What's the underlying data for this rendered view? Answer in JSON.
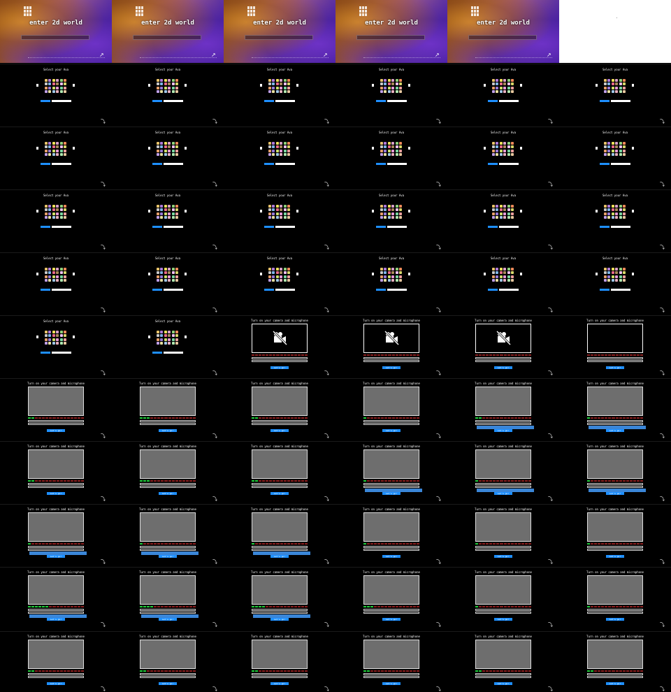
{
  "landing": {
    "hero_title": "enter 2d world",
    "corner_mark": "↗"
  },
  "avatar_screen": {
    "title": "Select your Ava",
    "continue_label": "",
    "random_label": "",
    "avatar_colors": [
      "#e8c36a",
      "#b07ad8",
      "#f2e25a",
      "#d9a0c8",
      "#8fd17a",
      "#f08a5a",
      "#c9c9c9",
      "#7fb6e8",
      "#e86a8a",
      "#a88a5a",
      "#f0c0f0",
      "#d8d86a",
      "#e8a06a",
      "#9a7ad8",
      "#cfe06a",
      "#e89ad8",
      "#7ad8a0",
      "#f0a0a0",
      "#c0a0e8",
      "#e8e0a0",
      "#a0c8e8",
      "#e8b0c0",
      "#b0e8b0",
      "#e8c8a0"
    ]
  },
  "camera_screen": {
    "title": "Turn on your camera and microphone",
    "camera_device": "",
    "mic_device": "",
    "go_label": "Let's go!",
    "icons": {
      "camera_off": "video-off-icon"
    }
  },
  "corner_glyph": "⤵",
  "frames": [
    {
      "kind": "landing",
      "variant": "cosmic"
    },
    {
      "kind": "landing",
      "variant": "cosmic"
    },
    {
      "kind": "landing",
      "variant": "cosmic"
    },
    {
      "kind": "landing",
      "variant": "cosmic"
    },
    {
      "kind": "landing",
      "variant": "cosmic"
    },
    {
      "kind": "blank",
      "variant": "white"
    },
    {
      "kind": "avatar"
    },
    {
      "kind": "avatar"
    },
    {
      "kind": "avatar"
    },
    {
      "kind": "avatar"
    },
    {
      "kind": "avatar"
    },
    {
      "kind": "avatar"
    },
    {
      "kind": "avatar"
    },
    {
      "kind": "avatar"
    },
    {
      "kind": "avatar"
    },
    {
      "kind": "avatar"
    },
    {
      "kind": "avatar"
    },
    {
      "kind": "avatar"
    },
    {
      "kind": "avatar"
    },
    {
      "kind": "avatar"
    },
    {
      "kind": "avatar"
    },
    {
      "kind": "avatar"
    },
    {
      "kind": "avatar"
    },
    {
      "kind": "avatar"
    },
    {
      "kind": "avatar"
    },
    {
      "kind": "avatar"
    },
    {
      "kind": "avatar"
    },
    {
      "kind": "avatar"
    },
    {
      "kind": "avatar"
    },
    {
      "kind": "avatar"
    },
    {
      "kind": "avatar"
    },
    {
      "kind": "avatar"
    },
    {
      "kind": "camera",
      "nocam": true,
      "icon": true,
      "meter_on": 0
    },
    {
      "kind": "camera",
      "nocam": true,
      "icon": true,
      "meter_on": 0
    },
    {
      "kind": "camera",
      "nocam": true,
      "icon": true,
      "meter_on": 0
    },
    {
      "kind": "camera",
      "nocam": true,
      "icon": false,
      "meter_on": 0
    },
    {
      "kind": "camera",
      "meter_on": 2
    },
    {
      "kind": "camera",
      "meter_on": 3
    },
    {
      "kind": "camera",
      "meter_on": 2
    },
    {
      "kind": "camera",
      "meter_on": 1
    },
    {
      "kind": "camera",
      "meter_on": 2,
      "dropdown": true
    },
    {
      "kind": "camera",
      "meter_on": 1,
      "dropdown": true
    },
    {
      "kind": "camera",
      "meter_on": 2
    },
    {
      "kind": "camera",
      "meter_on": 3
    },
    {
      "kind": "camera",
      "meter_on": 2
    },
    {
      "kind": "camera",
      "meter_on": 1,
      "dropdown": true
    },
    {
      "kind": "camera",
      "meter_on": 1,
      "dropdown": true
    },
    {
      "kind": "camera",
      "meter_on": 1,
      "dropdown": true
    },
    {
      "kind": "camera",
      "meter_on": 1,
      "dropdown": true
    },
    {
      "kind": "camera",
      "meter_on": 1,
      "dropdown": true
    },
    {
      "kind": "camera",
      "meter_on": 1,
      "dropdown": true
    },
    {
      "kind": "camera",
      "meter_on": 1
    },
    {
      "kind": "camera",
      "meter_on": 1
    },
    {
      "kind": "camera",
      "meter_on": 1
    },
    {
      "kind": "camera",
      "meter_on": 6,
      "dropdown": true
    },
    {
      "kind": "camera",
      "meter_on": 4,
      "dropdown": true
    },
    {
      "kind": "camera",
      "meter_on": 4,
      "dropdown": true
    },
    {
      "kind": "camera",
      "meter_on": 3
    },
    {
      "kind": "camera",
      "meter_on": 1
    },
    {
      "kind": "camera",
      "meter_on": 1
    },
    {
      "kind": "camera",
      "meter_on": 2
    },
    {
      "kind": "camera",
      "meter_on": 2
    },
    {
      "kind": "camera",
      "meter_on": 2
    },
    {
      "kind": "camera",
      "meter_on": 2
    },
    {
      "kind": "camera",
      "meter_on": 2
    },
    {
      "kind": "camera",
      "meter_on": 2
    }
  ]
}
